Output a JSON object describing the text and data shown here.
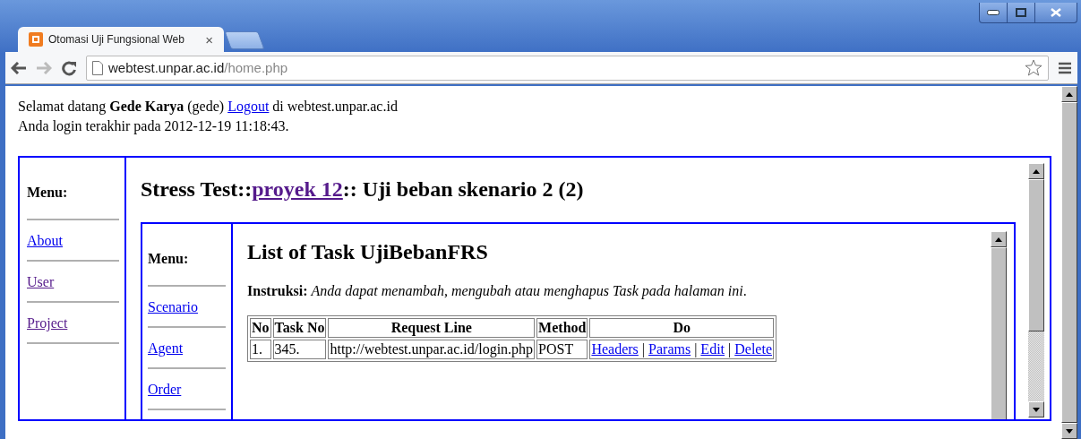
{
  "browser": {
    "tab": {
      "title": "Otomasi Uji Fungsional Web",
      "close": "×"
    },
    "address": {
      "host": "webtest.unpar.ac.id",
      "path": "/home.php"
    }
  },
  "welcome": {
    "text": "Selamat datang **Gede Karya** (gede)",
    "logout": "Logout",
    "suffix": "di webtest.unpar.ac.id"
  },
  "last_login": "Anda login terakhir pada 2012-12-19 11:18:43.",
  "outer_menu": {
    "title": "Menu:",
    "items": [
      {
        "label": "About",
        "visited": false
      },
      {
        "label": "User",
        "visited": true
      },
      {
        "label": "Project",
        "visited": true
      }
    ]
  },
  "header": {
    "prefix": "Stress Test::",
    "link": "proyek 12",
    "link_visited": true,
    "suffix": ":: Uji beban skenario 2 (2)"
  },
  "inner_menu": {
    "title": "Menu:",
    "items": [
      {
        "label": "Scenario",
        "visited": false
      },
      {
        "label": "Agent",
        "visited": false
      },
      {
        "label": "Order",
        "visited": false
      }
    ]
  },
  "task_page": {
    "title": "List of Task UjiBebanFRS",
    "instruction": "**Instruksi:** *Anda dapat menambah, mengubah atau menghapus Task pada halaman ini*.",
    "table": {
      "columns": [
        "No",
        "Task No",
        "Request Line",
        "Method",
        "Do"
      ],
      "action_separator": "|",
      "rows": [
        {
          "no": "1.",
          "task_no": "345.",
          "request_line": "http://webtest.unpar.ac.id/login.php",
          "method": "POST",
          "actions": [
            "Headers",
            "Params",
            "Edit",
            "Delete"
          ]
        }
      ]
    }
  }
}
